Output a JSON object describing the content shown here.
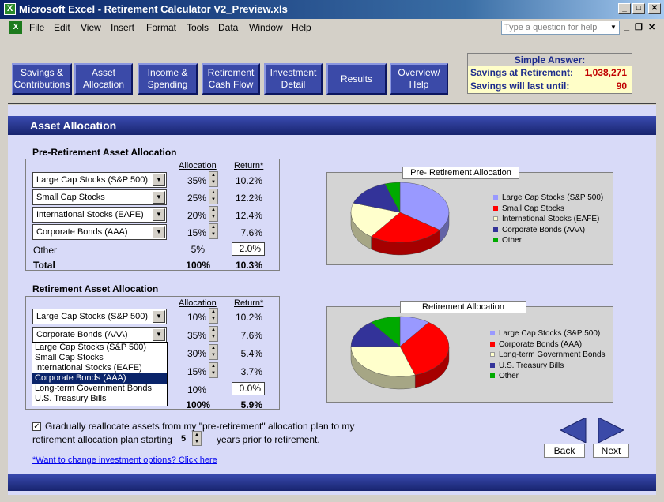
{
  "window": {
    "title": "Microsoft Excel - Retirement Calculator V2_Preview.xls",
    "min": "_",
    "max": "□",
    "close": "✕"
  },
  "menu": {
    "items": [
      "File",
      "Edit",
      "View",
      "Insert",
      "Format",
      "Tools",
      "Data",
      "Window",
      "Help"
    ],
    "ask_placeholder": "Type a question for help",
    "doc_min": "_",
    "doc_restore": "❐",
    "doc_close": "✕"
  },
  "nav": {
    "buttons": [
      "Savings & Contributions",
      "Asset Allocation",
      "Income & Spending",
      "Retirement Cash Flow",
      "Investment Detail",
      "Results",
      "Overview/ Help"
    ]
  },
  "simple_answer": {
    "title": "Simple Answer:",
    "savings_label": "Savings at Retirement:",
    "savings_value": "1,038,271",
    "last_label": "Savings will last until:",
    "last_value": "90"
  },
  "page_title": "Asset Allocation",
  "pre": {
    "title": "Pre-Retirement Asset Allocation",
    "col_alloc": "Allocation",
    "col_return": "Return*",
    "rows": [
      {
        "asset": "Large Cap Stocks (S&P 500)",
        "alloc": "35%",
        "ret": "10.2%"
      },
      {
        "asset": "Small Cap Stocks",
        "alloc": "25%",
        "ret": "12.2%"
      },
      {
        "asset": "International Stocks (EAFE)",
        "alloc": "20%",
        "ret": "12.4%"
      },
      {
        "asset": "Corporate Bonds (AAA)",
        "alloc": "15%",
        "ret": "7.6%"
      }
    ],
    "other_label": "Other",
    "other_alloc": "5%",
    "other_ret": "2.0%",
    "total_label": "Total",
    "total_alloc": "100%",
    "total_ret": "10.3%"
  },
  "ret": {
    "title": "Retirement Asset Allocation",
    "col_alloc": "Allocation",
    "col_return": "Return*",
    "rows": [
      {
        "asset": "Large Cap Stocks (S&P 500)",
        "alloc": "10%",
        "ret": "10.2%"
      },
      {
        "asset": "Corporate Bonds (AAA)",
        "alloc": "35%",
        "ret": "7.6%"
      },
      {
        "asset": "",
        "alloc": "30%",
        "ret": "5.4%"
      },
      {
        "asset": "",
        "alloc": "15%",
        "ret": "3.7%"
      }
    ],
    "other_alloc": "10%",
    "other_ret": "0.0%",
    "total_alloc": "100%",
    "total_ret": "5.9%",
    "dropdown_options": [
      "Large Cap Stocks (S&P 500)",
      "Small Cap Stocks",
      "International Stocks (EAFE)",
      "Corporate Bonds (AAA)",
      "Long-term Government Bonds",
      "U.S. Treasury Bills"
    ],
    "dropdown_selected": 3
  },
  "charts": [
    {
      "title": "Pre- Retirement Allocation",
      "slices": [
        {
          "label": "Large Cap Stocks (S&P 500)",
          "value": 35,
          "color": "#9999ff"
        },
        {
          "label": "Small Cap Stocks",
          "value": 25,
          "color": "#ff0000"
        },
        {
          "label": "International Stocks (EAFE)",
          "value": 20,
          "color": "#ffffcc"
        },
        {
          "label": "Corporate Bonds (AAA)",
          "value": 15,
          "color": "#333399"
        },
        {
          "label": "Other",
          "value": 5,
          "color": "#00aa00"
        }
      ]
    },
    {
      "title": "Retirement Allocation",
      "slices": [
        {
          "label": "Large Cap Stocks (S&P 500)",
          "value": 10,
          "color": "#9999ff"
        },
        {
          "label": "Corporate Bonds (AAA)",
          "value": 35,
          "color": "#ff0000"
        },
        {
          "label": "Long-term Government Bonds",
          "value": 30,
          "color": "#ffffcc"
        },
        {
          "label": "U.S. Treasury Bills",
          "value": 15,
          "color": "#333399"
        },
        {
          "label": "Other",
          "value": 10,
          "color": "#00aa00"
        }
      ]
    }
  ],
  "realloc": {
    "line1": "Gradually reallocate assets from my \"pre-retirement\" allocation plan to my",
    "line2_a": "retirement allocation plan starting",
    "years": "5",
    "line2_b": "years prior to retirement.",
    "checked": "✓"
  },
  "link": "*Want to change investment options?  Click here",
  "back_label": "Back",
  "next_label": "Next"
}
